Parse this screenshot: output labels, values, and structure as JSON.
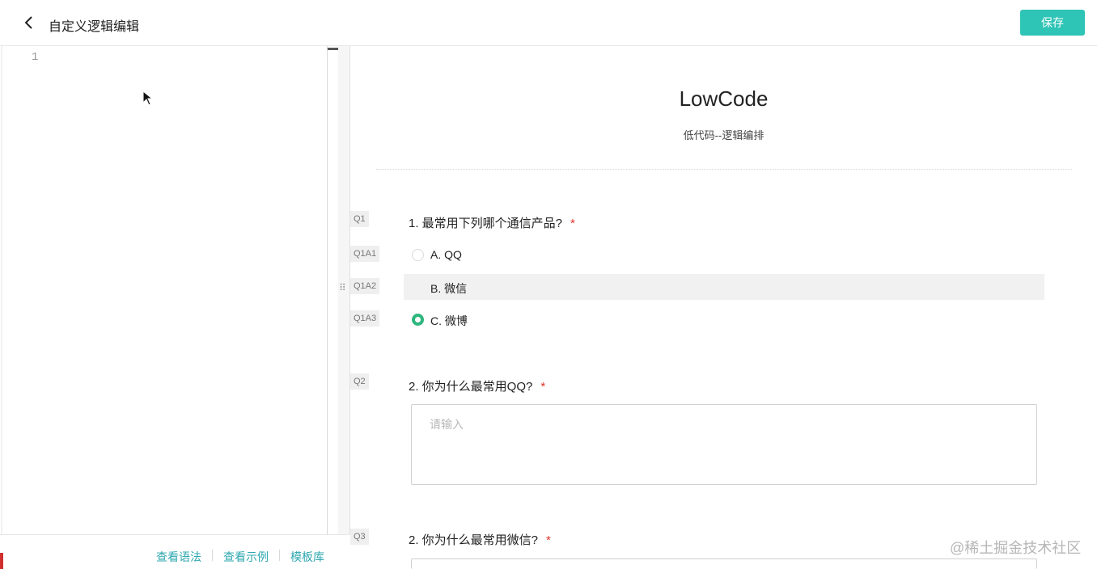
{
  "header": {
    "title": "自定义逻辑编辑",
    "save_label": "保存"
  },
  "editor": {
    "line_number": "1",
    "footer_links": [
      "查看语法",
      "查看示例",
      "模板库"
    ]
  },
  "preview": {
    "title": "LowCode",
    "subtitle": "低代码--逻辑编排",
    "questions": [
      {
        "tag": "Q1",
        "title": "1. 最常用下列哪个通信产品?",
        "required": "*",
        "options": [
          {
            "tag": "Q1A1",
            "label": "A. QQ",
            "checked": false
          },
          {
            "tag": "Q1A2",
            "label": "B. 微信",
            "checked": false
          },
          {
            "tag": "Q1A3",
            "label": "C. 微博",
            "checked": true
          }
        ]
      },
      {
        "tag": "Q2",
        "title": "2. 你为什么最常用QQ?",
        "required": "*",
        "placeholder": "请输入"
      },
      {
        "tag": "Q3",
        "title": "2. 你为什么最常用微信?",
        "required": "*"
      }
    ]
  },
  "watermark": "@稀土掘金技术社区",
  "colors": {
    "accent": "#2ec4b6",
    "link": "#2ea7b0",
    "required": "#e0352b",
    "radio_checked": "#2eb67d"
  }
}
